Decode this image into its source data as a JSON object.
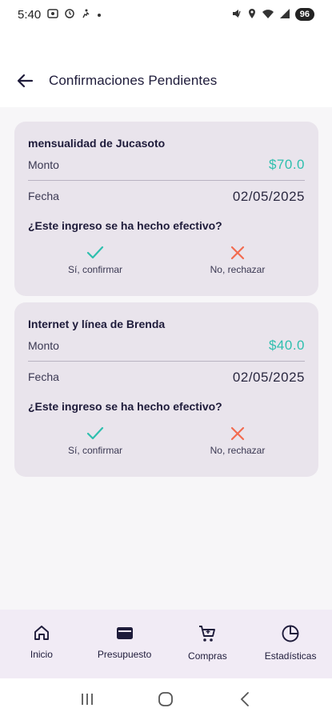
{
  "status_bar": {
    "time": "5:40",
    "left_icons": [
      "photo-icon",
      "clock-icon",
      "run-icon",
      "dot-icon"
    ],
    "right_icons": [
      "mute-icon",
      "location-icon",
      "wifi-icon",
      "signal-icon"
    ],
    "battery": "96"
  },
  "header": {
    "title": "Confirmaciones Pendientes"
  },
  "cards": [
    {
      "title": "mensualidad de Jucasoto",
      "amount_label": "Monto",
      "amount": "$70.0",
      "date_label": "Fecha",
      "date": "02/05/2025",
      "question": "¿Este ingreso se ha hecho efectivo?",
      "confirm_label": "Sí, confirmar",
      "reject_label": "No, rechazar"
    },
    {
      "title": "Internet y línea de Brenda",
      "amount_label": "Monto",
      "amount": "$40.0",
      "date_label": "Fecha",
      "date": "02/05/2025",
      "question": "¿Este ingreso se ha hecho efectivo?",
      "confirm_label": "Sí, confirmar",
      "reject_label": "No, rechazar"
    }
  ],
  "bottom_nav": [
    {
      "label": "Inicio",
      "icon": "home-icon"
    },
    {
      "label": "Presupuesto",
      "icon": "wallet-icon"
    },
    {
      "label": "Compras",
      "icon": "cart-icon"
    },
    {
      "label": "Estadísticas",
      "icon": "pie-chart-icon"
    }
  ],
  "colors": {
    "accent": "#2ebfae",
    "reject": "#f26b50",
    "card": "#e9e4ec",
    "nav_bg": "#f1ebf5"
  }
}
